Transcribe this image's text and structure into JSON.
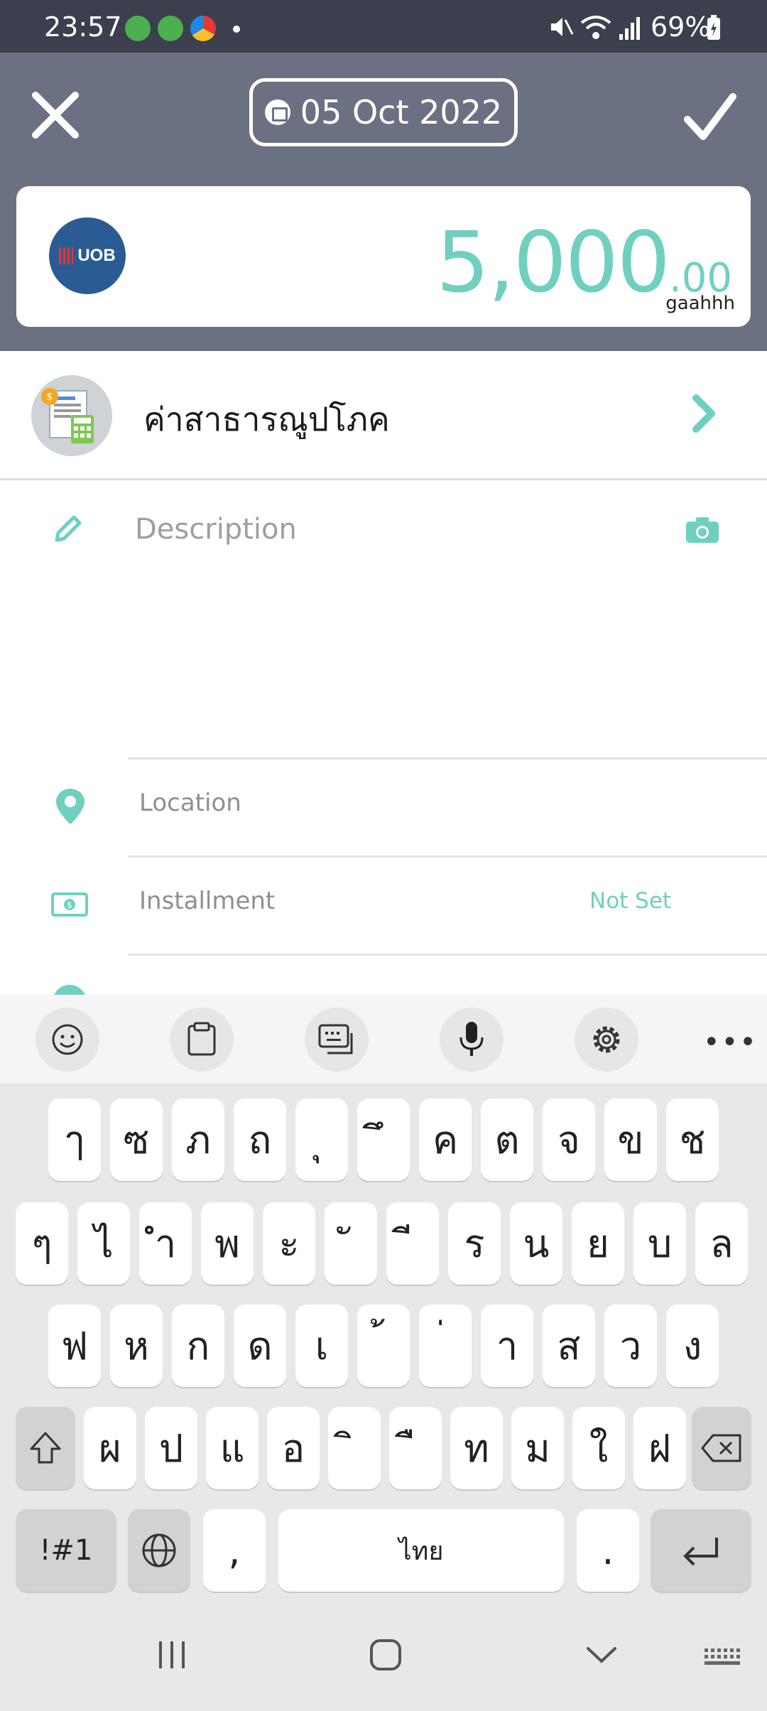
{
  "status_bar": {
    "time": "23:57",
    "battery": "69%",
    "icons": [
      "app-notification-icon",
      "app-notification-icon",
      "browser-notification-icon",
      "more-dot",
      "mute-icon",
      "wifi-icon",
      "signal-icon",
      "battery-charging-icon"
    ]
  },
  "header": {
    "date": "05 Oct 2022",
    "close_icon": "close-icon",
    "confirm_icon": "check-icon"
  },
  "amount_card": {
    "bank_logo_text": "UOB",
    "amount_integer": "5,000",
    "amount_decimal": ".00",
    "account_name": "gaahhh",
    "accent_color": "#6fd0c0"
  },
  "category": {
    "name": "ค่าสาธารณูปโภค",
    "icon": "utility-bill-icon"
  },
  "description": {
    "placeholder": "Description",
    "icon": "pencil-icon",
    "attach_icon": "camera-icon"
  },
  "fields": [
    {
      "label": "Location",
      "value": "",
      "icon": "location-pin-icon"
    },
    {
      "label": "Installment",
      "value": "Not Set",
      "icon": "cash-icon"
    }
  ],
  "keyboard": {
    "toolbar": [
      "emoji-icon",
      "clipboard-icon",
      "keyboard-layout-icon",
      "microphone-icon",
      "settings-icon",
      "more-icon"
    ],
    "toolbar_more": "•••",
    "row1": [
      "ๅ",
      "ซ",
      "ภ",
      "ถ",
      "ุ",
      "ึ",
      "ค",
      "ต",
      "จ",
      "ข",
      "ช"
    ],
    "row2": [
      "ๆ",
      "ไ",
      "ำ",
      "พ",
      "ะ",
      "ั",
      "ี",
      "ร",
      "น",
      "ย",
      "บ",
      "ล"
    ],
    "row3": [
      "ฟ",
      "ห",
      "ก",
      "ด",
      "เ",
      "้",
      "่",
      "า",
      "ส",
      "ว",
      "ง"
    ],
    "row4": [
      "ผ",
      "ป",
      "แ",
      "อ",
      "ิ",
      "ื",
      "ท",
      "ม",
      "ใ",
      "ฝ"
    ],
    "symbols_key": "!#1",
    "comma_key": ",",
    "space_label": "ไทย",
    "period_key": "."
  },
  "nav_bar": [
    "recent-apps-icon",
    "home-icon",
    "back-icon",
    "keyboard-toggle-icon"
  ]
}
